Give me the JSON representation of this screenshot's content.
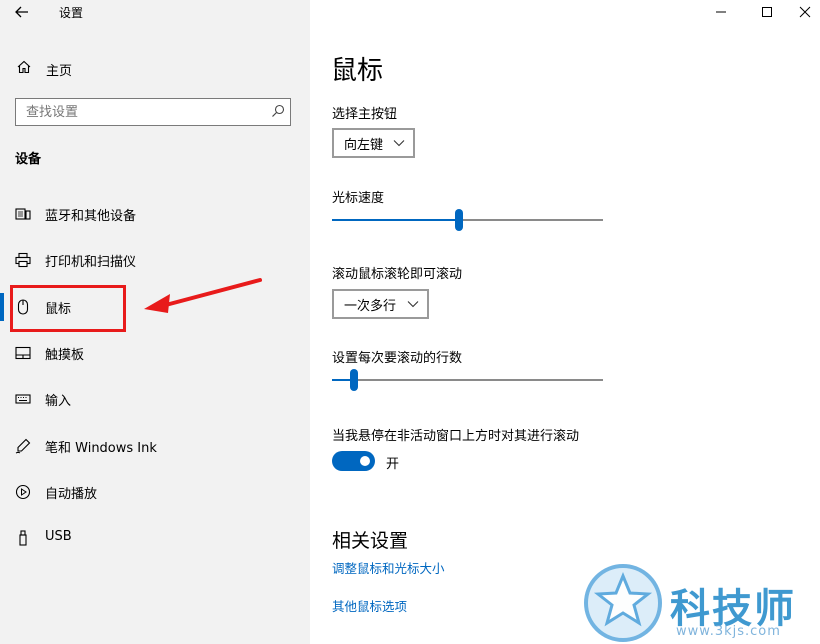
{
  "window": {
    "title": "设置",
    "controls": [
      "minimize",
      "maximize",
      "close"
    ]
  },
  "sidebar": {
    "home_label": "主页",
    "search_placeholder": "查找设置",
    "section_label": "设备",
    "items": [
      {
        "label": "蓝牙和其他设备",
        "icon": "bluetooth-devices-icon"
      },
      {
        "label": "打印机和扫描仪",
        "icon": "printer-icon"
      },
      {
        "label": "鼠标",
        "icon": "mouse-icon",
        "active": true
      },
      {
        "label": "触摸板",
        "icon": "touchpad-icon"
      },
      {
        "label": "输入",
        "icon": "keyboard-icon"
      },
      {
        "label": "笔和 Windows Ink",
        "icon": "pen-icon"
      },
      {
        "label": "自动播放",
        "icon": "autoplay-icon"
      },
      {
        "label": "USB",
        "icon": "usb-icon"
      }
    ]
  },
  "main": {
    "title": "鼠标",
    "primary_button": {
      "label": "选择主按钮",
      "value": "向左键"
    },
    "cursor_speed": {
      "label": "光标速度",
      "value_fraction": 0.47
    },
    "scroll_mode": {
      "label": "滚动鼠标滚轮即可滚动",
      "value": "一次多行"
    },
    "lines_to_scroll": {
      "label": "设置每次要滚动的行数",
      "value_fraction": 0.08
    },
    "inactive_scroll": {
      "label": "当我悬停在非活动窗口上方时对其进行滚动",
      "state": "开",
      "on": true
    },
    "related": {
      "title": "相关设置",
      "links": [
        "调整鼠标和光标大小",
        "其他鼠标选项"
      ]
    }
  },
  "watermark": {
    "text": "科技师",
    "url": "www.3kjs.com"
  },
  "colors": {
    "accent": "#0067c0",
    "sidebar_bg": "#f2f2f2",
    "highlight": "#e81b1b"
  }
}
